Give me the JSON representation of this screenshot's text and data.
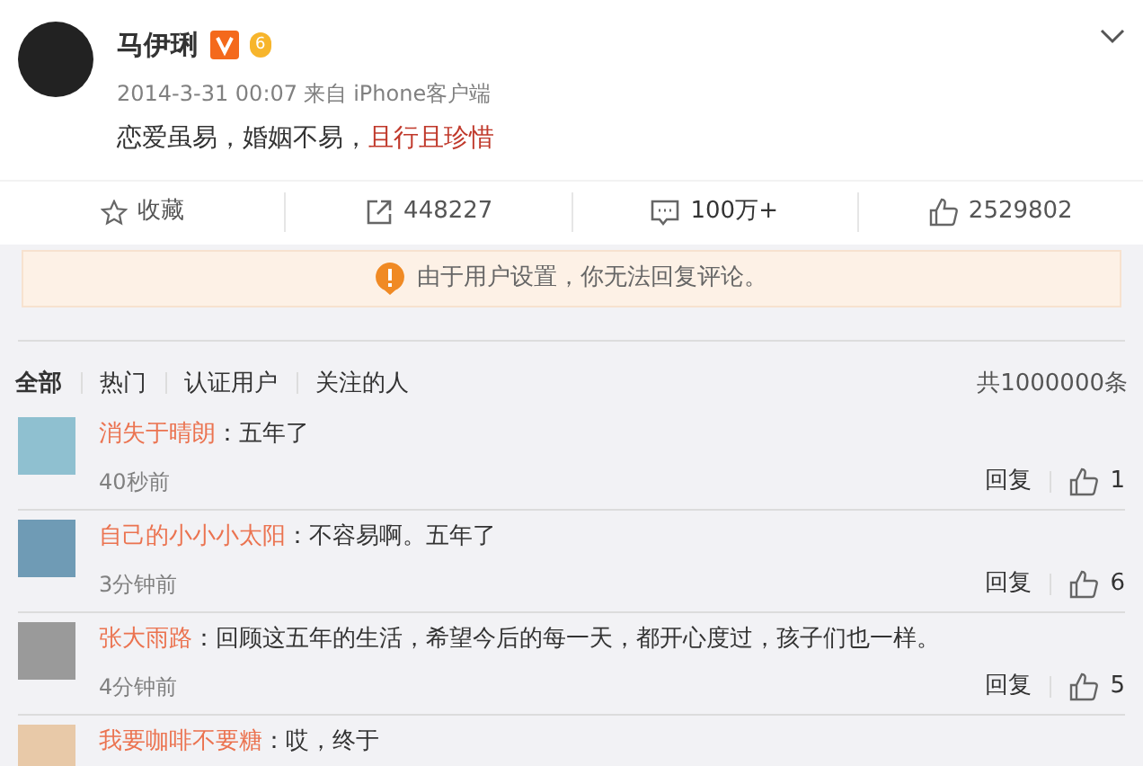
{
  "post": {
    "author": "马伊琍",
    "verified": true,
    "level_badge": "6",
    "time": "2014-3-31 00:07",
    "source": "来自 iPhone客户端",
    "text": "恋爱虽易，婚姻不易，",
    "link": "且行且珍惜"
  },
  "actions": [
    {
      "kind": "favorite",
      "label": "收藏",
      "selected": false
    },
    {
      "kind": "repost",
      "label": "448227",
      "selected": false
    },
    {
      "kind": "comment",
      "label": "100万+",
      "selected": true
    },
    {
      "kind": "like",
      "label": "2529802",
      "selected": false
    }
  ],
  "notice": "由于用户设置，你无法回复评论。",
  "filters": [
    {
      "label": "全部",
      "selected": true
    },
    {
      "label": "热门",
      "selected": false
    },
    {
      "label": "认证用户",
      "selected": false
    },
    {
      "label": "关注的人",
      "selected": false
    }
  ],
  "total": "共1000000条",
  "comments": [
    {
      "user": "消失于晴朗",
      "text": "：五年了",
      "time": "40秒前",
      "reply": "回复",
      "likes": "1",
      "color": "#8fc0d0"
    },
    {
      "user": "自己的小小小太阳",
      "text": "：不容易啊。五年了",
      "time": "3分钟前",
      "reply": "回复",
      "likes": "6",
      "color": "#6f9bb5"
    },
    {
      "user": "张大雨路",
      "text": "：回顾这五年的生活，希望今后的每一天，都开心度过，孩子们也一样。",
      "time": "4分钟前",
      "reply": "回复",
      "likes": "5",
      "color": "#9a9a9a"
    },
    {
      "user": "我要咖啡不要糖",
      "text": "：哎，终于",
      "color": "#e8c9a8"
    }
  ]
}
